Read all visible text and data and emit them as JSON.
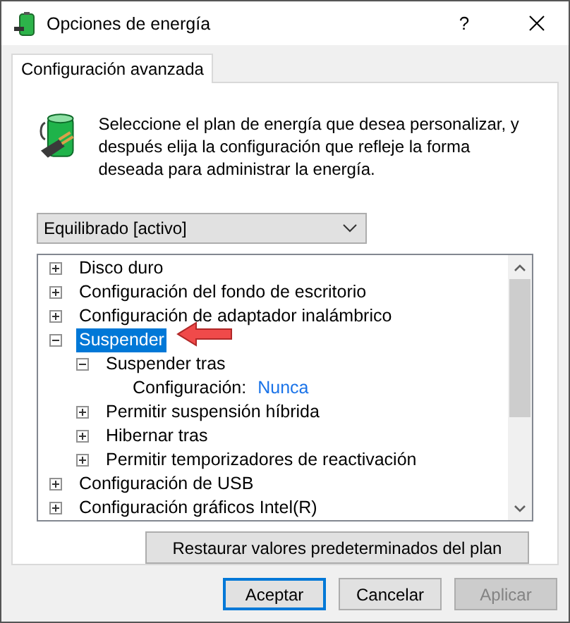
{
  "window": {
    "title": "Opciones de energía",
    "help": "?"
  },
  "tabs": [
    {
      "label": "Configuración avanzada",
      "selected": true
    }
  ],
  "description": "Seleccione el plan de energía que desea personalizar, y después elija la configuración que refleje la forma deseada para administrar la energía.",
  "plan_select": {
    "value": "Equilibrado [activo]"
  },
  "tree": [
    {
      "label": "Disco duro",
      "expanded": false,
      "selected": false
    },
    {
      "label": "Configuración del fondo de escritorio",
      "expanded": false,
      "selected": false
    },
    {
      "label": "Configuración de adaptador inalámbrico",
      "expanded": false,
      "selected": false
    },
    {
      "label": "Suspender",
      "expanded": true,
      "selected": true,
      "children": [
        {
          "label": "Suspender tras",
          "expanded": true,
          "selected": false,
          "children": [
            {
              "kind": "setting",
              "label": "Configuración:",
              "value": "Nunca"
            }
          ]
        },
        {
          "label": "Permitir suspensión híbrida",
          "expanded": false,
          "selected": false
        },
        {
          "label": "Hibernar tras",
          "expanded": false,
          "selected": false
        },
        {
          "label": "Permitir temporizadores de reactivación",
          "expanded": false,
          "selected": false
        }
      ]
    },
    {
      "label": "Configuración de USB",
      "expanded": false,
      "selected": false
    },
    {
      "label": "Configuración gráficos Intel(R)",
      "expanded": false,
      "selected": false
    }
  ],
  "restore_button": "Restaurar valores predeterminados del plan",
  "buttons": [
    {
      "label": "Aceptar",
      "kind": "default",
      "disabled": false
    },
    {
      "label": "Cancelar",
      "kind": "normal",
      "disabled": false
    },
    {
      "label": "Aplicar",
      "kind": "normal",
      "disabled": true
    }
  ]
}
